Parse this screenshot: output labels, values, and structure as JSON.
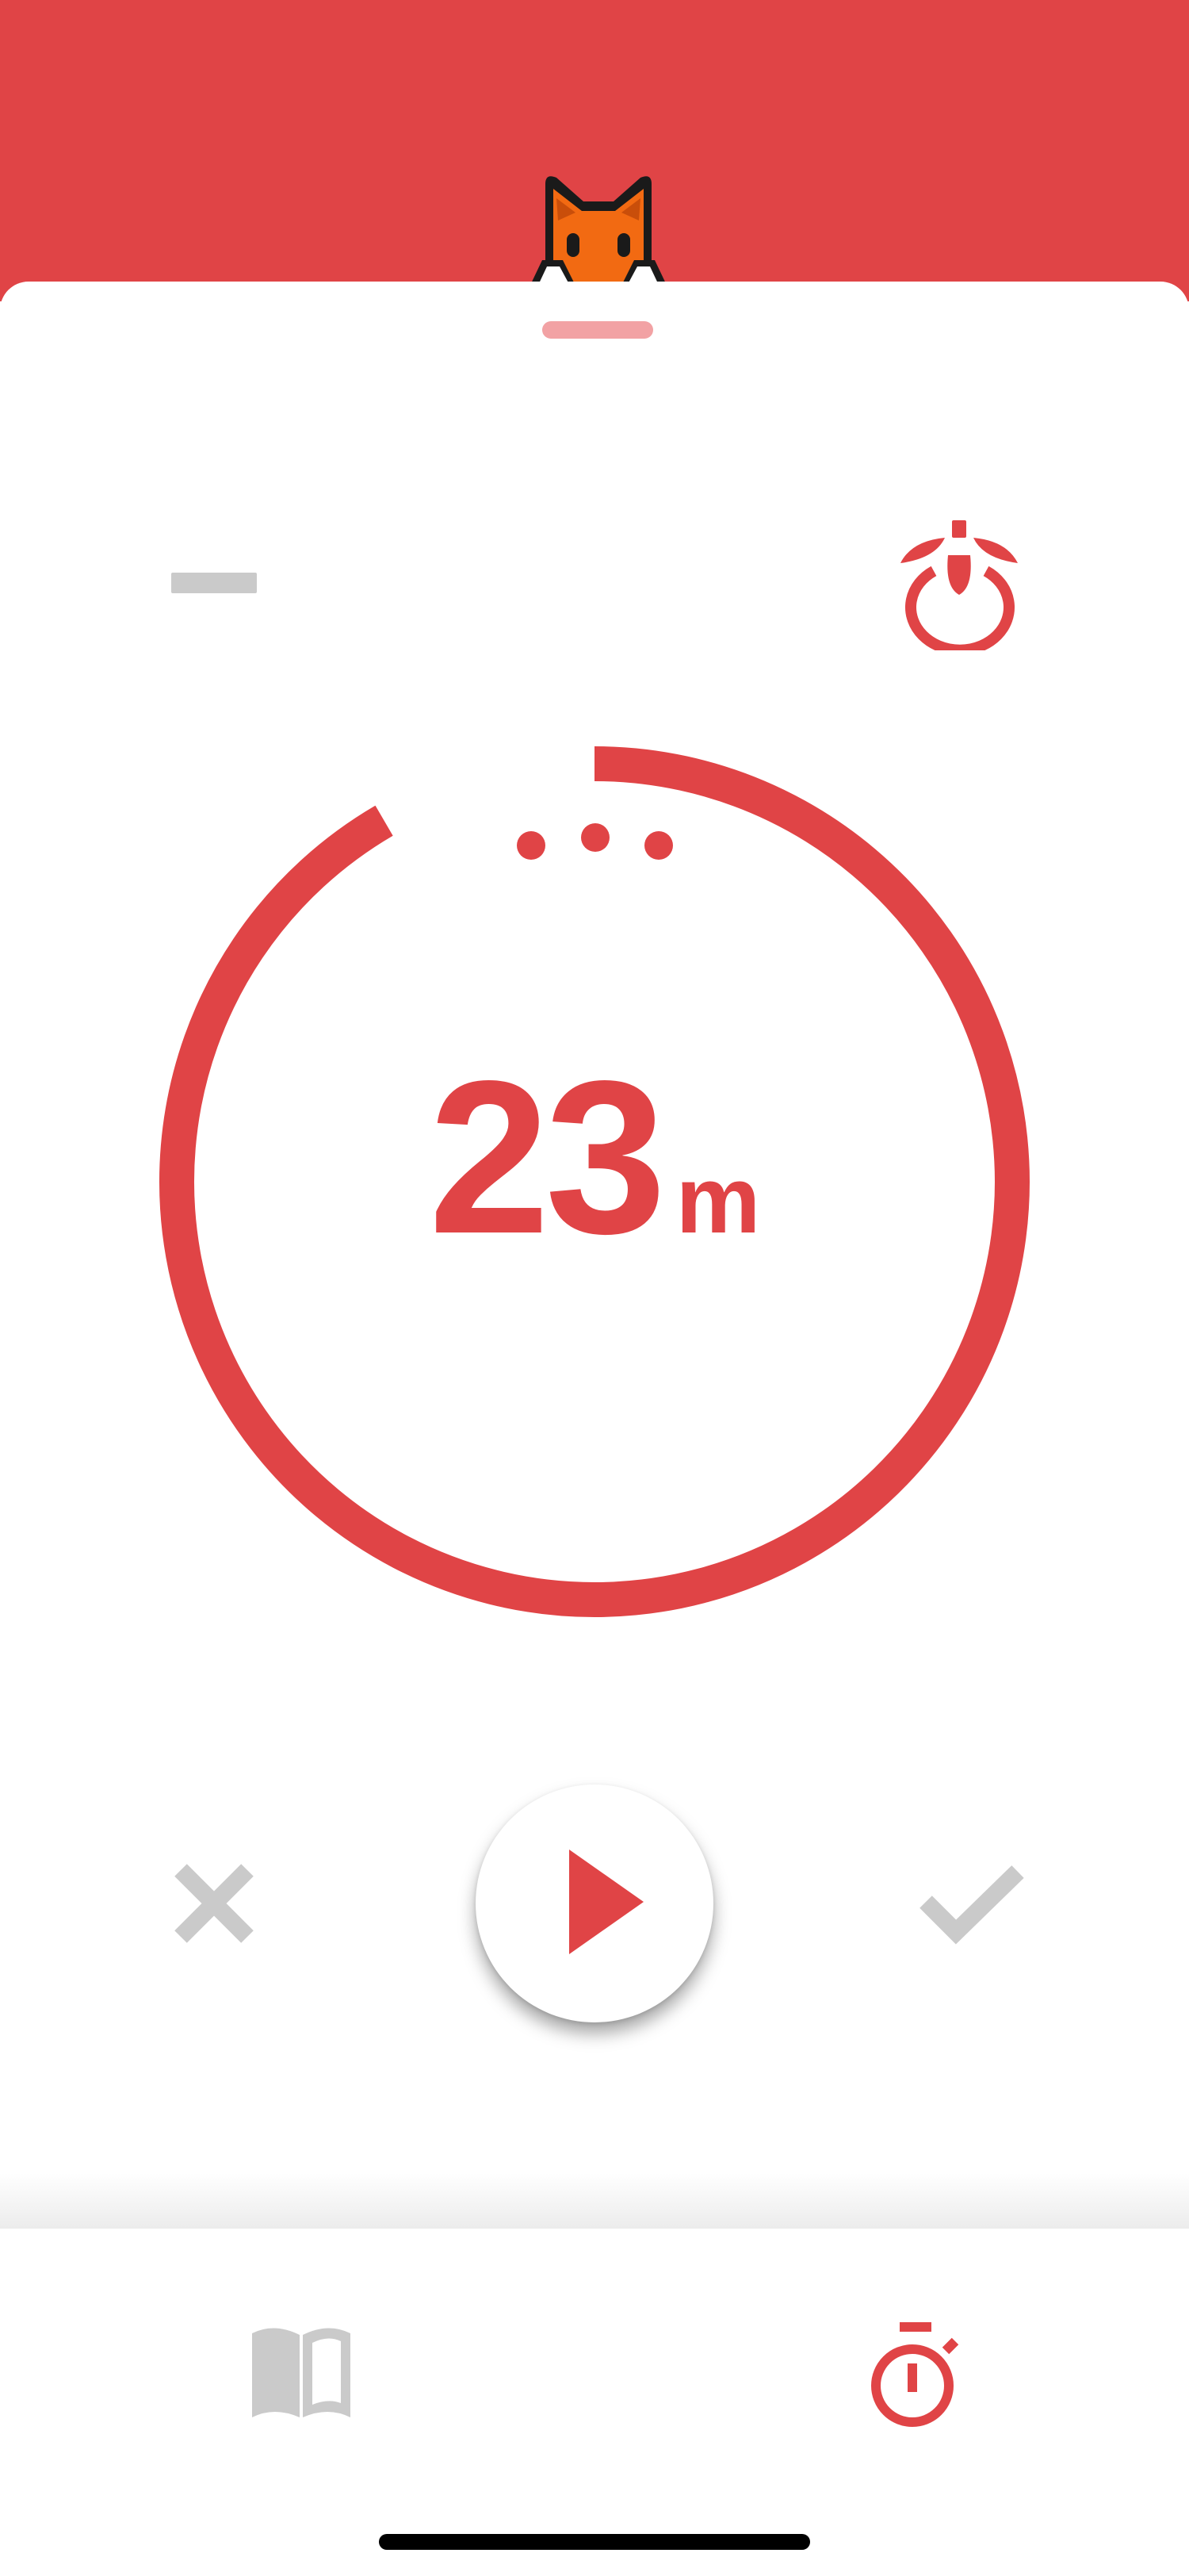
{
  "colors": {
    "accent": "#E04446",
    "accent_light": "#F2A2A4",
    "inactive": "#CACACA",
    "mascot_orange": "#F26A12"
  },
  "header": {
    "mascot_icon": "fox-icon"
  },
  "timer": {
    "minutes": "23",
    "unit": "m",
    "ring_fraction_remaining": 0.916,
    "session_indicator_dots": 3
  },
  "controls": {
    "decrease_icon": "minus-icon",
    "tomato_icon": "tomato-timer-icon",
    "cancel_icon": "close-icon",
    "play_icon": "play-icon",
    "done_icon": "checkmark-icon"
  },
  "tabs": [
    {
      "id": "journal",
      "icon": "book-icon",
      "active": false
    },
    {
      "id": "timer",
      "icon": "stopwatch-icon",
      "active": true
    }
  ]
}
